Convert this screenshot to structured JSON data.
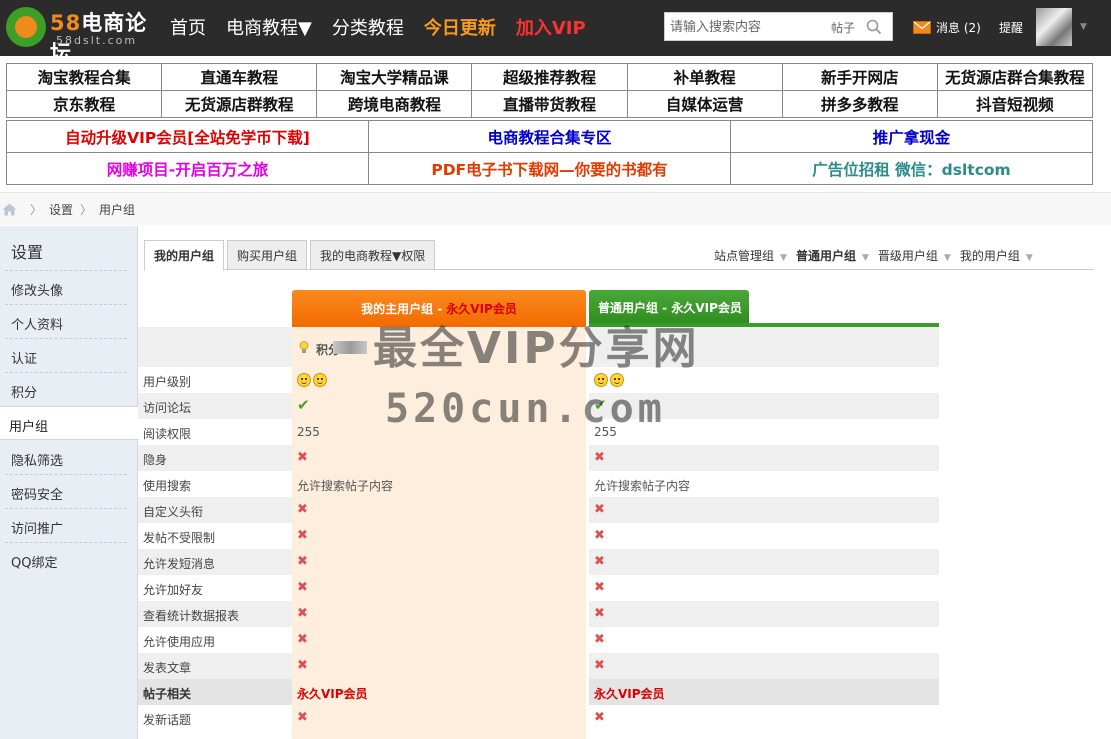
{
  "header": {
    "logo_num": "58",
    "logo_name": "电商论坛",
    "logo_domain": "58dslt.com",
    "nav": [
      {
        "label": "首页",
        "style": "normal"
      },
      {
        "label": "电商教程▼",
        "style": "normal"
      },
      {
        "label": "分类教程",
        "style": "normal"
      },
      {
        "label": "今日更新",
        "style": "orange"
      },
      {
        "label": "加入VIP",
        "style": "red"
      }
    ],
    "search_placeholder": "请输入搜索内容",
    "search_type": "帖子",
    "messages": "消息 (2)",
    "remind": "提醒"
  },
  "quicklinks": [
    [
      "淘宝教程合集",
      "直通车教程",
      "淘宝大学精品课",
      "超级推荐教程",
      "补单教程",
      "新手开网店",
      "无货源店群合集教程"
    ],
    [
      "京东教程",
      "无货源店群教程",
      "跨境电商教程",
      "直播带货教程",
      "自媒体运营",
      "拼多多教程",
      "抖音短视频"
    ]
  ],
  "promos": [
    [
      {
        "label": "自动升级VIP会员[全站免学币下载]",
        "color": "#e00000"
      },
      {
        "label": "电商教程合集专区",
        "color": "#0000cc"
      },
      {
        "label": "推广拿现金",
        "color": "#0000cc"
      }
    ],
    [
      {
        "label": "网赚项目-开启百万之旅",
        "color": "#e600e6"
      },
      {
        "label": "PDF电子书下载网—你要的书都有",
        "color": "#e03c00"
      },
      {
        "label": "广告位招租 微信：dsltcom",
        "color": "#2b8c8c"
      }
    ]
  ],
  "breadcrumb": [
    "设置",
    "用户组"
  ],
  "sidebar": {
    "title": "设置",
    "items": [
      "修改头像",
      "个人资料",
      "认证",
      "积分",
      "用户组",
      "隐私筛选",
      "密码安全",
      "访问推广",
      "QQ绑定"
    ],
    "active_index": 4
  },
  "tabs": [
    "我的用户组",
    "购买用户组",
    "我的电商教程▼权限"
  ],
  "group_links": [
    "站点管理组",
    "普通用户组",
    "晋级用户组",
    "我的用户组"
  ],
  "columns": {
    "mine_label": "我的主用户组 - ",
    "mine_vip": "永久VIP会员",
    "normal": "普通用户组 - 永久VIP会员"
  },
  "points_label": "积分",
  "rows": [
    {
      "label": "用户级别",
      "mine": "smiley",
      "normal": "smiley",
      "shade": false
    },
    {
      "label": "访问论坛",
      "mine": "check",
      "normal": "check",
      "shade": true
    },
    {
      "label": "阅读权限",
      "mine": "255",
      "normal": "255",
      "shade": false
    },
    {
      "label": "隐身",
      "mine": "x",
      "normal": "x",
      "shade": true
    },
    {
      "label": "使用搜索",
      "mine": "允许搜索帖子内容",
      "normal": "允许搜索帖子内容",
      "shade": false
    },
    {
      "label": "自定义头衔",
      "mine": "x",
      "normal": "x",
      "shade": true
    },
    {
      "label": "发帖不受限制",
      "mine": "x",
      "normal": "x",
      "shade": false
    },
    {
      "label": "允许发短消息",
      "mine": "x",
      "normal": "x",
      "shade": true
    },
    {
      "label": "允许加好友",
      "mine": "x",
      "normal": "x",
      "shade": false
    },
    {
      "label": "查看统计数据报表",
      "mine": "x",
      "normal": "x",
      "shade": true
    },
    {
      "label": "允许使用应用",
      "mine": "x",
      "normal": "x",
      "shade": false
    },
    {
      "label": "发表文章",
      "mine": "x",
      "normal": "x",
      "shade": true
    },
    {
      "label": "帖子相关",
      "mine": "永久VIP会员",
      "normal": "永久VIP会员",
      "shade": true,
      "section": true
    },
    {
      "label": "发新话题",
      "mine": "x",
      "normal": "x",
      "shade": false
    }
  ],
  "watermark": [
    "最全VIP分享网",
    "520cun.com"
  ]
}
